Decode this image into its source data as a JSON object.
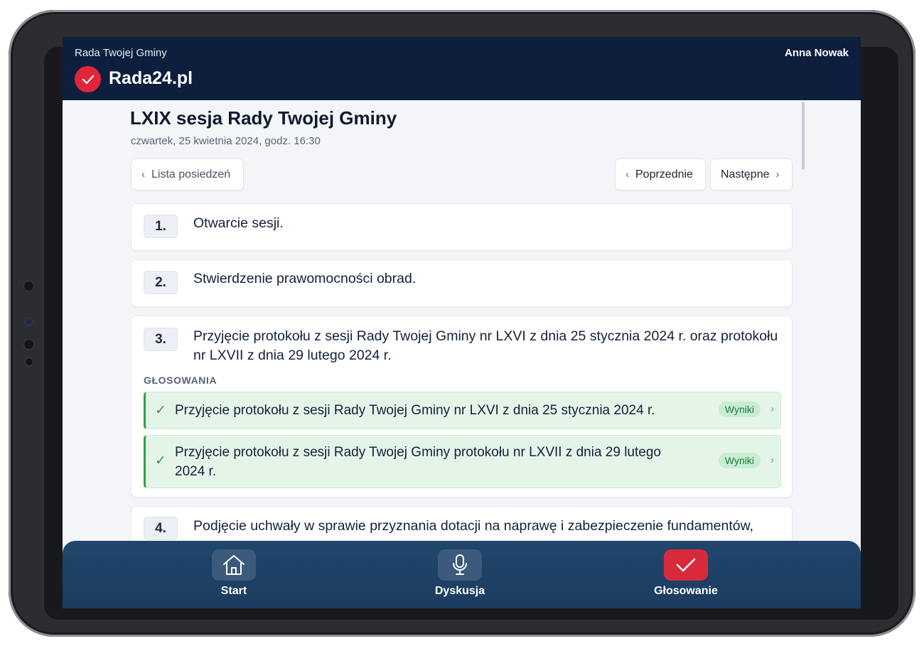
{
  "header": {
    "org_name": "Rada Twojej Gminy",
    "brand": "Rada24.pl",
    "user": "Anna Nowak"
  },
  "session": {
    "title": "LXIX sesja Rady Twojej Gminy",
    "date": "czwartek, 25 kwietnia 2024, godz. 16:30"
  },
  "nav_buttons": {
    "list": "Lista posiedzeń",
    "prev": "Poprzednie",
    "next": "Następne"
  },
  "agenda": [
    {
      "number": "1.",
      "title": "Otwarcie sesji."
    },
    {
      "number": "2.",
      "title": "Stwierdzenie prawomocności obrad."
    },
    {
      "number": "3.",
      "title": "Przyjęcie protokołu z sesji Rady Twojej Gminy nr LXVI z dnia 25 stycznia 2024 r. oraz protokołu nr LXVII z dnia 29 lutego 2024 r.",
      "votes_label": "GŁOSOWANIA",
      "votes": [
        {
          "title": "Przyjęcie protokołu z sesji Rady Twojej Gminy nr LXVI z dnia 25 stycznia 2024 r.",
          "badge": "Wyniki"
        },
        {
          "title": "Przyjęcie protokołu z sesji Rady Twojej Gminy protokołu nr LXVII z dnia 29 lutego 2024 r.",
          "badge": "Wyniki"
        }
      ]
    },
    {
      "number": "4.",
      "title": "Podjęcie uchwały w sprawie przyznania dotacji na naprawę i zabezpieczenie fundamentów,"
    }
  ],
  "bottom_nav": [
    {
      "label": "Start",
      "icon": "home-icon",
      "active": false
    },
    {
      "label": "Dyskusja",
      "icon": "microphone-icon",
      "active": false
    },
    {
      "label": "Głosowanie",
      "icon": "check-icon",
      "active": true
    }
  ],
  "colors": {
    "header_bg": "#0d1f3d",
    "accent_red": "#e0263a",
    "vote_green": "#28a34a",
    "nav_bg": "#1f4268"
  }
}
